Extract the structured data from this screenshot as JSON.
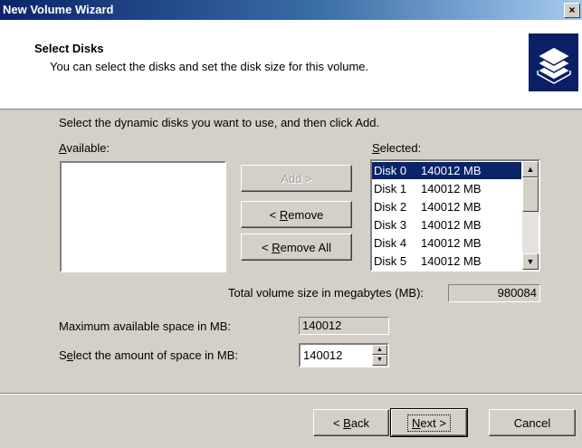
{
  "window": {
    "title": "New Volume Wizard",
    "close_glyph": "×"
  },
  "header": {
    "title": "Select Disks",
    "subtitle": "You can select the disks and set the disk size for this volume.",
    "icon": "disk-stack-icon"
  },
  "instruction": "Select the dynamic disks you want to use, and then click Add.",
  "available": {
    "label_pre": "",
    "label_u": "A",
    "label_post": "vailable:"
  },
  "selected": {
    "label_u": "S",
    "label_post": "elected:",
    "items": [
      {
        "disk": "Disk 0",
        "size": "140012 MB"
      },
      {
        "disk": "Disk 1",
        "size": "140012 MB"
      },
      {
        "disk": "Disk 2",
        "size": "140012 MB"
      },
      {
        "disk": "Disk 3",
        "size": "140012 MB"
      },
      {
        "disk": "Disk 4",
        "size": "140012 MB"
      },
      {
        "disk": "Disk 5",
        "size": "140012 MB"
      }
    ],
    "selected_index": 0
  },
  "buttons": {
    "add": "Add >",
    "remove_pre": "< ",
    "remove_u": "R",
    "remove_post": "emove",
    "remove_all_pre": "< ",
    "remove_all_u": "R",
    "remove_all_post": "emove All",
    "back_pre": "< ",
    "back_u": "B",
    "back_post": "ack",
    "next_u": "N",
    "next_post": "ext >",
    "cancel": "Cancel"
  },
  "total": {
    "label": "Total volume size in megabytes (MB):",
    "value": "980084"
  },
  "max_space": {
    "label": "Maximum available space in MB:",
    "value": "140012"
  },
  "amount": {
    "label_pre": "S",
    "label_u": "e",
    "label_post": "lect the amount of space in MB:",
    "value": "140012"
  }
}
